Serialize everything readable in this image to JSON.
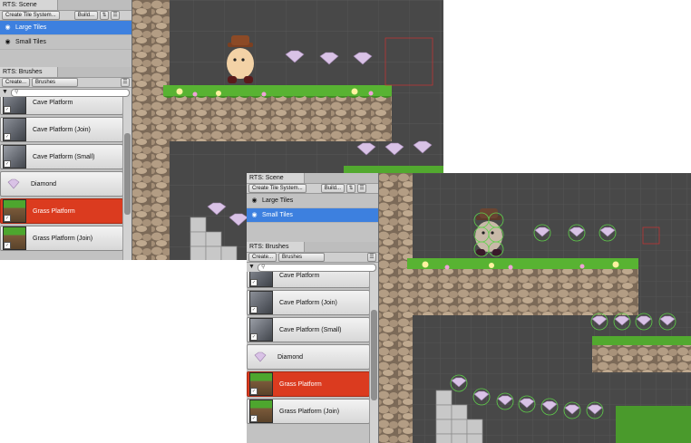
{
  "screens": [
    {
      "scene_window": {
        "tab": "RTS: Scene",
        "create_label": "Create Tile System...",
        "build_label": "Build...",
        "layers": [
          {
            "name": "Large Tiles",
            "selected": true
          },
          {
            "name": "Small Tiles",
            "selected": false
          }
        ]
      },
      "brushes_window": {
        "tab": "RTS: Brushes",
        "create_label": "Create...",
        "dropdown_value": "Brushes",
        "search_placeholder": "",
        "items": [
          {
            "name": "Cave Platform",
            "thumb": "cave",
            "selected": false
          },
          {
            "name": "Cave Platform (Join)",
            "thumb": "cave",
            "selected": false
          },
          {
            "name": "Cave Platform (Small)",
            "thumb": "cave-s",
            "selected": false
          },
          {
            "name": "Diamond",
            "thumb": "diamond",
            "selected": false
          },
          {
            "name": "Grass Platform",
            "thumb": "grass",
            "selected": true
          },
          {
            "name": "Grass Platform (Join)",
            "thumb": "grass",
            "selected": false
          }
        ]
      }
    },
    {
      "scene_window": {
        "tab": "RTS: Scene",
        "create_label": "Create Tile System...",
        "build_label": "Build...",
        "layers": [
          {
            "name": "Large Tiles",
            "selected": false
          },
          {
            "name": "Small Tiles",
            "selected": true
          }
        ]
      },
      "brushes_window": {
        "tab": "RTS: Brushes",
        "create_label": "Create...",
        "dropdown_value": "Brushes",
        "search_placeholder": "",
        "items": [
          {
            "name": "Cave Platform",
            "thumb": "cave",
            "selected": false
          },
          {
            "name": "Cave Platform (Join)",
            "thumb": "cave",
            "selected": false
          },
          {
            "name": "Cave Platform (Small)",
            "thumb": "cave-s",
            "selected": false
          },
          {
            "name": "Diamond",
            "thumb": "diamond",
            "selected": false
          },
          {
            "name": "Grass Platform",
            "thumb": "grass",
            "selected": true
          },
          {
            "name": "Grass Platform (Join)",
            "thumb": "grass",
            "selected": false
          }
        ]
      }
    }
  ],
  "icons": {
    "eye": "eye-icon",
    "sort": "sort-icon",
    "menu": "menu-icon",
    "filter": "filter-icon",
    "search": "search-icon",
    "dropdown": "chevron-down-icon"
  },
  "colors": {
    "selection_blue": "#3d80df",
    "brush_selected": "#db3b1f",
    "panel_grey": "#c2c2c2",
    "scene_bg": "#4a4a4a",
    "grass": "#58b332",
    "stone": "#a08a72"
  }
}
